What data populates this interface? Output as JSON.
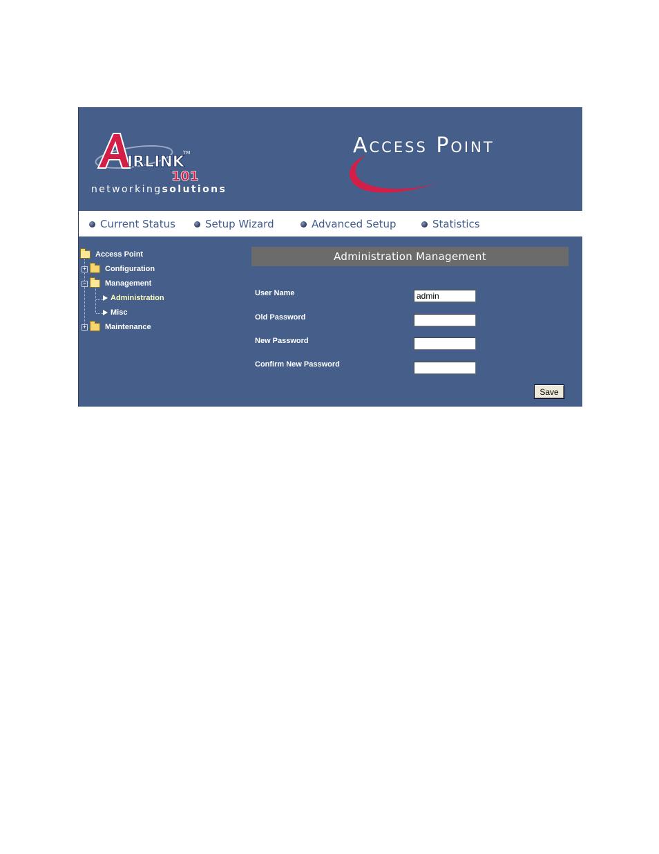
{
  "header": {
    "brand_logo_text": "AIRLINK 101",
    "tagline_light": "networking",
    "tagline_bold": "solutions",
    "product_title": "Access Point",
    "brand_red": "#d31f47"
  },
  "nav": {
    "items": [
      {
        "label": "Current Status"
      },
      {
        "label": "Setup Wizard"
      },
      {
        "label": "Advanced Setup"
      },
      {
        "label": "Statistics"
      }
    ]
  },
  "tree": {
    "root": "Access Point",
    "items": [
      {
        "label": "Configuration",
        "expanded": false
      },
      {
        "label": "Management",
        "expanded": true
      },
      {
        "label": "Administration",
        "selected": true
      },
      {
        "label": "Misc"
      },
      {
        "label": "Maintenance",
        "expanded": false
      }
    ],
    "expand_symbol": "+",
    "collapse_symbol": "−"
  },
  "main": {
    "section_title": "Administration Management",
    "fields": [
      {
        "label": "User Name",
        "value": "admin"
      },
      {
        "label": "Old Password",
        "value": ""
      },
      {
        "label": "New Password",
        "value": ""
      },
      {
        "label": "Confirm New Password",
        "value": ""
      }
    ],
    "save_label": "Save"
  },
  "colors": {
    "panel_background": "#455f8a",
    "section_bar": "#6b6b6b",
    "nav_text": "#3f5a8e"
  }
}
